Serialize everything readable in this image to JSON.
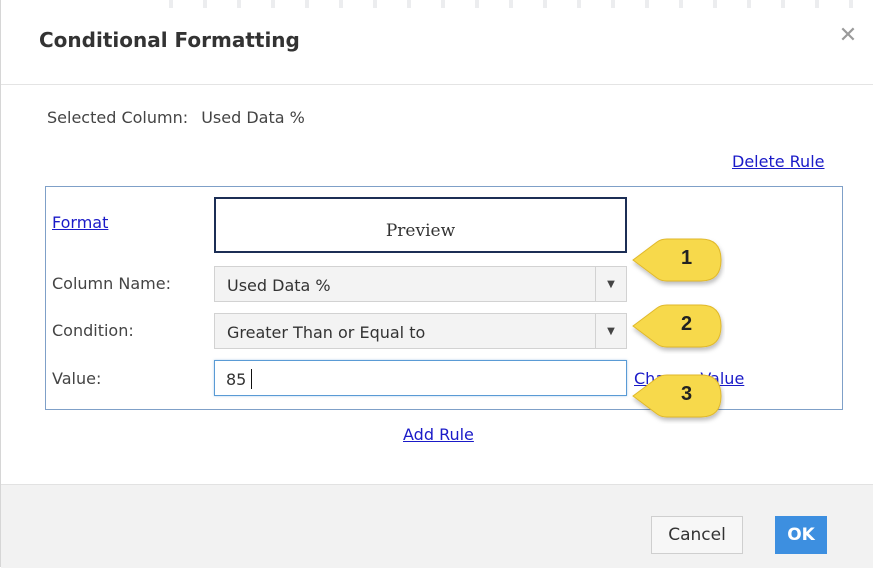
{
  "dialog": {
    "title": "Conditional Formatting",
    "close_icon": "close-icon"
  },
  "selected": {
    "label": "Selected Column:",
    "value": "Used Data %"
  },
  "rule": {
    "delete_label": "Delete Rule",
    "format_label": "Format",
    "preview_text": "Preview",
    "column_name_label": "Column Name:",
    "column_name_value": "Used Data %",
    "condition_label": "Condition:",
    "condition_value": "Greater Than or Equal to",
    "value_label": "Value:",
    "value_input": "85",
    "change_value_label": "Change Value",
    "add_rule_label": "Add Rule"
  },
  "footer": {
    "cancel_label": "Cancel",
    "ok_label": "OK"
  },
  "callouts": [
    {
      "number": "1"
    },
    {
      "number": "2"
    },
    {
      "number": "3"
    }
  ],
  "colors": {
    "link": "#1a1ac8",
    "ok_button": "#3d8fe0",
    "callout_fill": "#f7d94c",
    "preview_border": "#1c2e55"
  }
}
